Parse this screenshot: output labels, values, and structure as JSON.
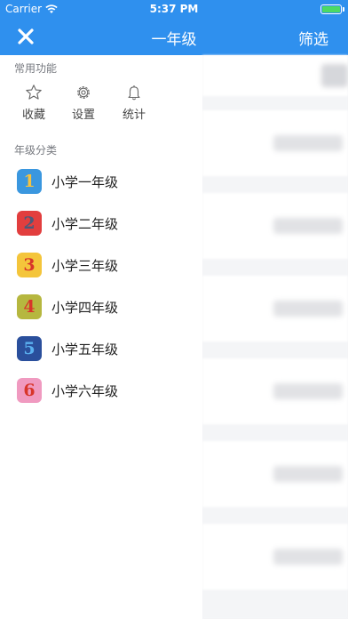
{
  "status_bar": {
    "carrier": "Carrier",
    "time": "5:37 PM",
    "battery_level": 1.0
  },
  "nav": {
    "title": "一年级",
    "filter_label": "筛选",
    "close_icon": "close-icon"
  },
  "drawer": {
    "common_title": "常用功能",
    "common_actions": [
      {
        "label": "收藏",
        "icon": "star-icon"
      },
      {
        "label": "设置",
        "icon": "gear-icon"
      },
      {
        "label": "统计",
        "icon": "bell-icon"
      }
    ],
    "grades_title": "年级分类",
    "grades": [
      {
        "label": "小学一年级",
        "badge": "1",
        "color": "#3a97df"
      },
      {
        "label": "小学二年级",
        "badge": "2",
        "color": "#e23e3e"
      },
      {
        "label": "小学三年级",
        "badge": "3",
        "color": "#f4c53b"
      },
      {
        "label": "小学四年级",
        "badge": "4",
        "color": "#b6b73f"
      },
      {
        "label": "小学五年级",
        "badge": "5",
        "color": "#2a4f9c"
      },
      {
        "label": "小学六年级",
        "badge": "6",
        "color": "#f09ac0"
      }
    ]
  },
  "colors": {
    "brand": "#2f90ee"
  }
}
